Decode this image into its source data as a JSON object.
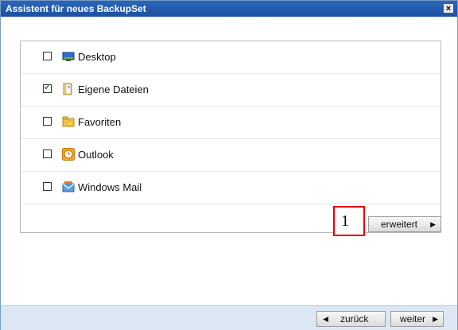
{
  "window": {
    "title": "Assistent für neues BackupSet",
    "close_symbol": "×"
  },
  "items": [
    {
      "label": "Desktop",
      "checked": false,
      "icon": "desktop-icon"
    },
    {
      "label": "Eigene Dateien",
      "checked": true,
      "icon": "folder-documents-icon"
    },
    {
      "label": "Favoriten",
      "checked": false,
      "icon": "favorites-folder-icon"
    },
    {
      "label": "Outlook",
      "checked": false,
      "icon": "outlook-icon"
    },
    {
      "label": "Windows Mail",
      "checked": false,
      "icon": "windows-mail-icon"
    }
  ],
  "buttons": {
    "advanced": "erweitert",
    "back": "zurück",
    "next": "weiter"
  },
  "annotation": {
    "label": "1",
    "color": "#e00000"
  },
  "colors": {
    "titlebar": "#2b67b6",
    "footer": "#dde7f3"
  }
}
